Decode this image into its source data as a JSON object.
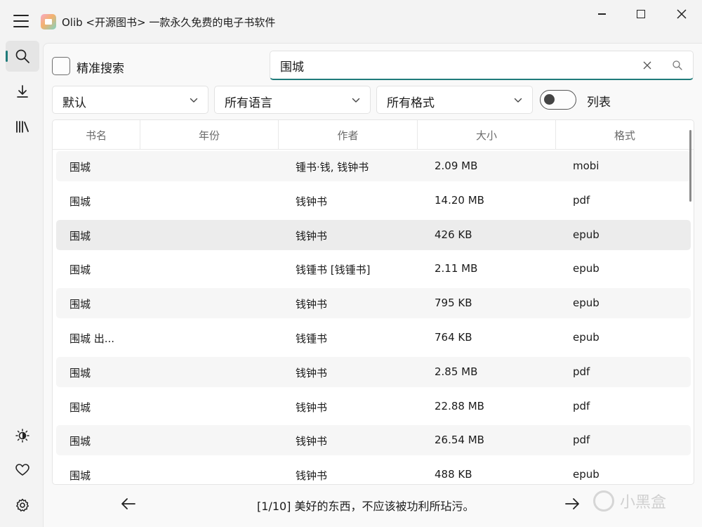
{
  "window": {
    "title": "Olib <开源图书> 一款永久免费的电子书软件"
  },
  "search": {
    "exact_label": "精准搜索",
    "exact_checked": false,
    "query": "围城"
  },
  "filters": {
    "sort": "默认",
    "language": "所有语言",
    "format": "所有格式",
    "list_toggle_label": "列表",
    "list_toggle_on": false
  },
  "table": {
    "headers": [
      "书名",
      "年份",
      "作者",
      "大小",
      "格式"
    ],
    "rows": [
      {
        "name": "围城",
        "year": "",
        "author": "锺书·钱, 钱钟书",
        "size": "2.09 MB",
        "format": "mobi"
      },
      {
        "name": "围城",
        "year": "",
        "author": "钱钟书",
        "size": "14.20 MB",
        "format": "pdf"
      },
      {
        "name": "围城",
        "year": "",
        "author": "钱钟书",
        "size": "426 KB",
        "format": "epub"
      },
      {
        "name": "围城",
        "year": "",
        "author": "钱锺书 [钱锺书]",
        "size": "2.11 MB",
        "format": "epub"
      },
      {
        "name": "围城",
        "year": "",
        "author": "钱钟书",
        "size": "795 KB",
        "format": "epub"
      },
      {
        "name": "围城 出...",
        "year": "",
        "author": "钱锺书",
        "size": "764 KB",
        "format": "epub"
      },
      {
        "name": "围城",
        "year": "",
        "author": "钱钟书",
        "size": "2.85 MB",
        "format": "pdf"
      },
      {
        "name": "围城",
        "year": "",
        "author": "钱钟书",
        "size": "22.88 MB",
        "format": "pdf"
      },
      {
        "name": "围城",
        "year": "",
        "author": "钱钟书",
        "size": "26.54 MB",
        "format": "pdf"
      },
      {
        "name": "围城",
        "year": "",
        "author": "钱钟书",
        "size": "488 KB",
        "format": "epub"
      }
    ]
  },
  "footer": {
    "status": "[1/10] 美好的东西，不应该被功利所玷污。"
  },
  "watermark": {
    "text": "小黑盒"
  },
  "nav": {
    "items": [
      "search-icon",
      "download-icon",
      "library-icon",
      "theme-icon",
      "heart-icon",
      "gear-icon"
    ],
    "active": "search-icon"
  },
  "colors": {
    "accent": "#1f7b7a",
    "background": "#f3f3f3",
    "panel": "#f9f9f9"
  }
}
